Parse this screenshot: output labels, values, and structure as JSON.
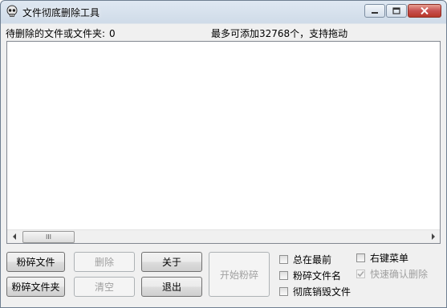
{
  "window": {
    "title": "文件彻底删除工具"
  },
  "info": {
    "pending_label": "待删除的文件或文件夹:",
    "pending_count": "0",
    "limit_text": "最多可添加32768个，支持拖动"
  },
  "scrollbar": {
    "thumb_grip": "III"
  },
  "buttons": {
    "shred_file": "粉碎文件",
    "shred_folder": "粉碎文件夹",
    "delete": "删除",
    "clear": "清空",
    "about": "关于",
    "exit": "退出",
    "start_shred": "开始粉碎"
  },
  "options": {
    "always_on_top": {
      "label": "总在最前",
      "checked": false
    },
    "shred_filename": {
      "label": "粉碎文件名",
      "checked": false
    },
    "destroy_file": {
      "label": "彻底销毁文件",
      "checked": false
    },
    "context_menu": {
      "label": "右键菜单",
      "checked": false
    },
    "quick_confirm": {
      "label": "快速确认删除",
      "checked": true,
      "disabled": true
    }
  },
  "icons": {
    "app": "skull-icon",
    "minimize": "minimize-icon",
    "maximize": "maximize-icon",
    "close": "close-icon",
    "scroll_left": "arrow-left-icon",
    "scroll_right": "arrow-right-icon"
  },
  "colors": {
    "close_button": "#c75050",
    "list_background": "#ffffff",
    "disabled_text": "#a0a0a0"
  }
}
